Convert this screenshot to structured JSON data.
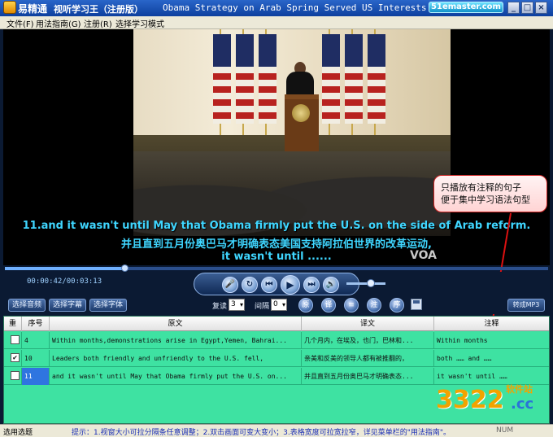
{
  "titlebar": {
    "app_name": "易精通",
    "app_subtitle": "视听学习王（注册版）",
    "window_title": "Obama Strategy on Arab Spring Served US Interests.avi",
    "site_badge": "51emaster.com",
    "min_label": "_",
    "max_label": "□",
    "close_label": "×"
  },
  "menu": {
    "items": [
      "文件(F)",
      "用法指南(G)",
      "注册(R)",
      "选择学习模式"
    ]
  },
  "video": {
    "subtitle_en": "11.and it wasn't until May that Obama firmly put the U.S. on the side of Arab reform.",
    "subtitle_zh": "并且直到五月份奥巴马才明确表态美国支持阿拉伯世界的改革运动,",
    "subtitle_hint": "it wasn't until ......",
    "logo": "VOA"
  },
  "callout": {
    "line1": "只播放有注释的句子",
    "line2": "便于集中学习语法句型"
  },
  "playback": {
    "time": "00:00:42/00:03:13",
    "progress": 0.22,
    "volume": 0.62,
    "buttons": [
      "mic-icon",
      "repeat-icon",
      "prev-icon",
      "play-icon",
      "next-icon",
      "volume-icon"
    ]
  },
  "toolbar": {
    "select_audio": "选择音频",
    "select_subtitle": "选择字幕",
    "select_font": "选择字体",
    "repeat_label": "复读",
    "repeat_value": "3",
    "interval_label": "间隔",
    "interval_value": "0",
    "round_buttons": [
      "原",
      "译",
      "≡",
      "注",
      "序"
    ],
    "convert_mp3": "转成MP3"
  },
  "table": {
    "headers": [
      "重",
      "序号",
      "原文",
      "译文",
      "注释"
    ],
    "rows": [
      {
        "checked": false,
        "num": "4",
        "original": "Within months,demonstrations arise in Egypt,Yemen, Bahrai...",
        "translation": "几个月内，在埃及，也门，巴林和...",
        "note": "Within months"
      },
      {
        "checked": true,
        "num": "10",
        "original": "Leaders both friendly and unfriendly to the U.S. fell,",
        "translation": "亲美和反美的领导人都有被推翻的，",
        "note": "both …… and ……"
      },
      {
        "checked": false,
        "num": "11",
        "original": "and it wasn't until May that Obama firmly put the U.S. on...",
        "translation": "并且直到五月份奥巴马才明确表态...",
        "note": "it wasn't until ……"
      }
    ]
  },
  "watermark": {
    "number": "3322",
    "suffix": ".cc",
    "site": "软件站"
  },
  "status": {
    "left": "选用选题",
    "tip": "提示：1.视窗大小可拉分隔条任意调整；2.双击画面可变大变小；3.表格宽度可拉宽拉窄，详见菜单栏的\"用法指南\"。",
    "num": "NUM"
  },
  "colors": {
    "subtitle": "#3fd6ff",
    "table_bg": "#3ee2a2",
    "titlebar": "#0d3f9e",
    "callout_border": "#cc2222"
  }
}
